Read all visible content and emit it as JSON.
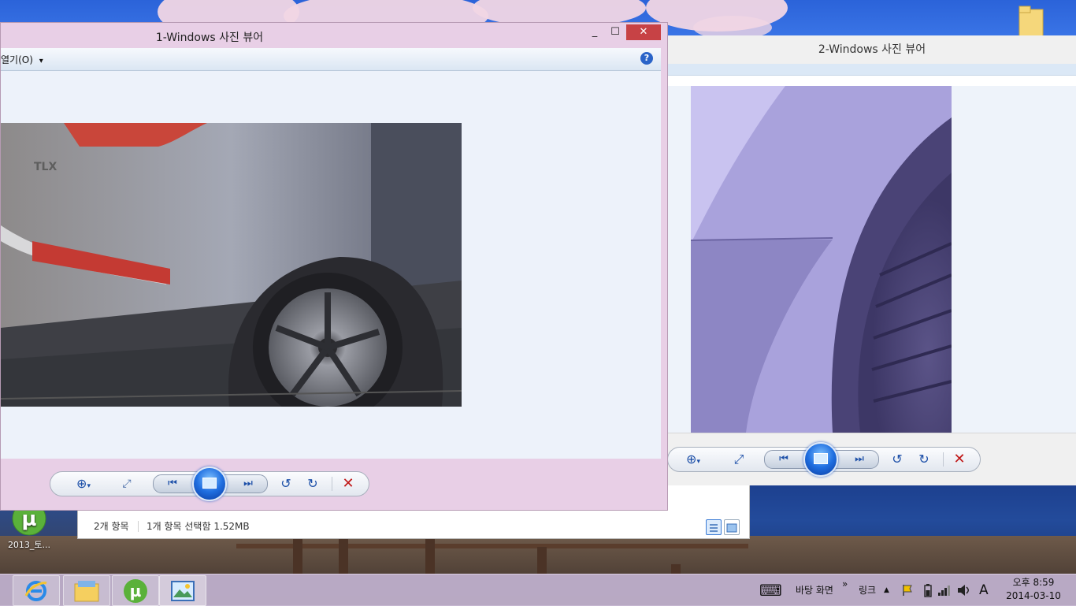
{
  "desktop": {
    "icons": [
      {
        "label": "2013_토...",
        "icon": "utorrent-icon"
      }
    ],
    "top_right_icon": "folder-icon"
  },
  "window1": {
    "title": "1-Windows 사진 뷰어",
    "caption": {
      "minimize": "_",
      "maximize": "☐",
      "close": "✕"
    },
    "menu": {
      "open_label": "열기(O)",
      "open_arrow": "▾",
      "help_label": "?"
    },
    "photo_alt": "car rear wheel photo"
  },
  "window2": {
    "title": "2-Windows 사진 뷰어",
    "photo_alt": "car fender close-up photo"
  },
  "controls": {
    "zoom": "⊕",
    "zoom_arrow": "▾",
    "fit": "⤢",
    "prev": "⏮",
    "next": "⏭",
    "rotate_ccw": "↺",
    "rotate_cw": "↻",
    "delete": "✕"
  },
  "explorer": {
    "item_count": "2개 항목",
    "selection": "1개 항목 선택함 1.52MB"
  },
  "taskbar": {
    "apps": [
      {
        "name": "internet-explorer-icon",
        "glyph": "e"
      },
      {
        "name": "file-explorer-icon",
        "glyph": "▭"
      },
      {
        "name": "utorrent-icon",
        "glyph": "µ"
      },
      {
        "name": "photo-viewer-icon",
        "glyph": "▣"
      }
    ],
    "keyboard_glyph": "⌨",
    "desktop_toolbar": "바탕 화면",
    "chevron": "»",
    "links_toolbar": "링크",
    "tray_arrow": "▲",
    "ime_label": "A",
    "time": "오후 8:59",
    "date": "2014-03-10"
  },
  "colors": {
    "window1_frame": "#e8cfe6",
    "close_button": "#c74245",
    "taskbar": "#c2b1cd",
    "accent_blue": "#1c4fa8"
  }
}
